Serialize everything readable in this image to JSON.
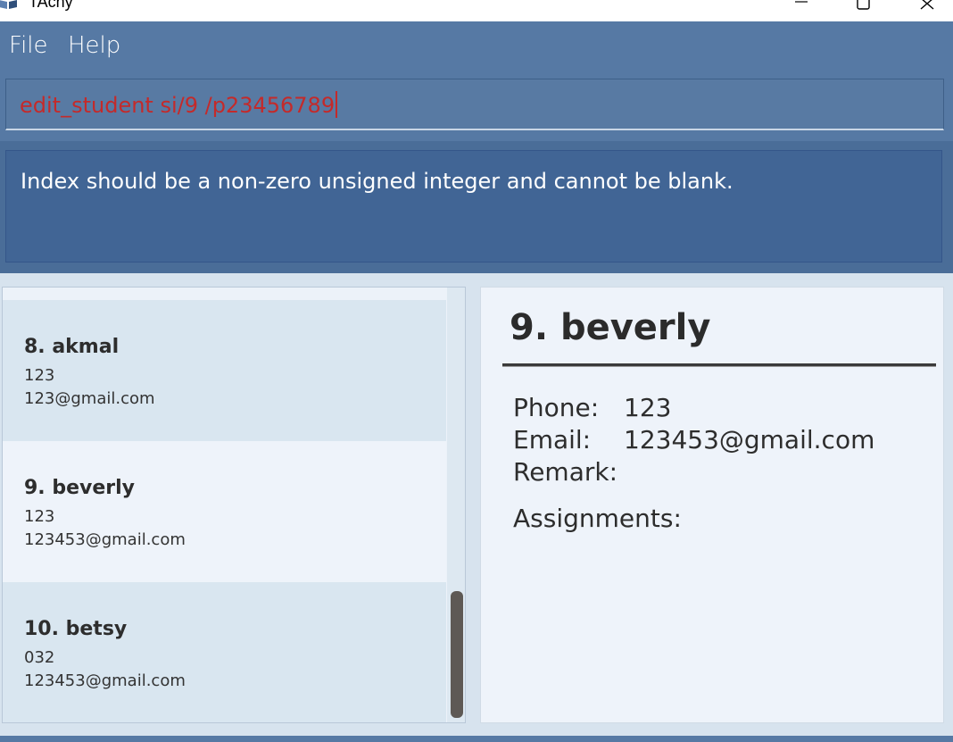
{
  "window": {
    "title": "TAchy",
    "minimize_glyph": "—",
    "maximize_glyph": "☐",
    "close_glyph": "✕"
  },
  "menu": {
    "items": [
      {
        "label": "File"
      },
      {
        "label": "Help"
      }
    ]
  },
  "command": {
    "value": "edit_student si/9 /p23456789"
  },
  "result": {
    "message": "Index should be a non-zero unsigned integer and cannot be blank."
  },
  "student_list": {
    "items": [
      {
        "name": "8. akmal",
        "phone": "123",
        "email": "123@gmail.com"
      },
      {
        "name": "9. beverly",
        "phone": "123",
        "email": "123453@gmail.com"
      },
      {
        "name": "10. betsy",
        "phone": "032",
        "email": "123453@gmail.com"
      }
    ]
  },
  "detail": {
    "title": "9. beverly",
    "phone_label": "Phone:",
    "phone_value": "123",
    "email_label": "Email:",
    "email_value": "123453@gmail.com",
    "remark_label": "Remark:",
    "assignments_label": "Assignments:"
  },
  "colors": {
    "menu_bg": "#5679a4",
    "result_bg": "#416595",
    "command_text": "#c42a2a",
    "card_alt": "#d9e6f0",
    "card_plain": "#eef3fa"
  },
  "icons": {
    "app": "book-icon"
  }
}
